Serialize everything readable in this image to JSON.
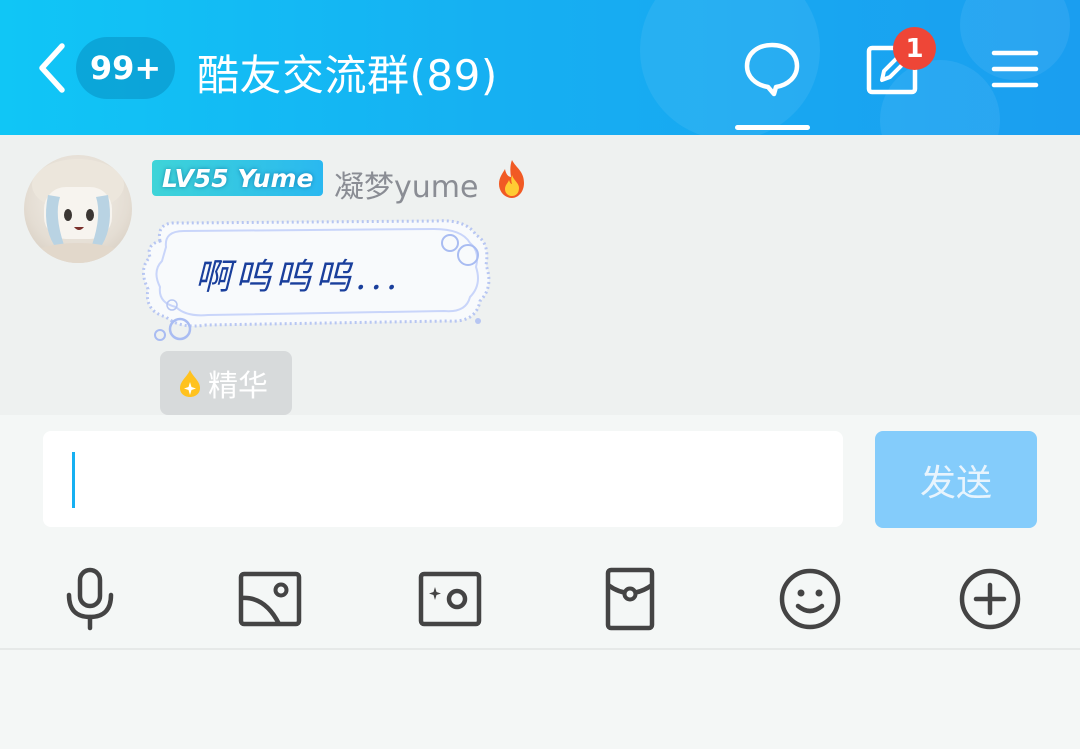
{
  "header": {
    "back_icon": "chevron-left-icon",
    "unread_count": "99+",
    "group_title": "酷友交流群(89)",
    "chat_tab_icon": "chat-bubble-icon",
    "notice_icon": "edit-note-icon",
    "notice_count": "1",
    "menu_icon": "hamburger-menu-icon"
  },
  "message": {
    "level_badge": "LV55 Yume",
    "nickname": "凝梦yume",
    "title_icon": "fire-icon",
    "text": "啊呜呜呜...",
    "essence_label": "精华",
    "essence_icon": "sparkle-drop-icon"
  },
  "composer": {
    "input_value": "",
    "send_label": "发送"
  },
  "toolbar": {
    "items": [
      {
        "icon": "microphone-icon"
      },
      {
        "icon": "image-icon"
      },
      {
        "icon": "camera-icon"
      },
      {
        "icon": "red-packet-icon"
      },
      {
        "icon": "emoji-icon"
      },
      {
        "icon": "plus-circle-icon"
      }
    ]
  },
  "colors": {
    "header_start": "#10c6f6",
    "header_end": "#1a9ef0",
    "badge_red": "#ee4637",
    "send_disabled": "#84ccfb",
    "bubble_text": "#1a3f9c"
  }
}
